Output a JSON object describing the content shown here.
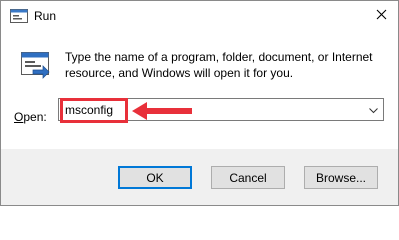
{
  "window": {
    "title": "Run",
    "close_glyph": "✕"
  },
  "icons": {
    "app": "run-app-icon",
    "close": "close-icon",
    "run": "run-program-icon",
    "dropdown": "chevron-down-icon"
  },
  "content": {
    "description": "Type the name of a program, folder, document, or Internet resource, and Windows will open it for you.",
    "open_label_accel": "O",
    "open_label_rest": "pen:",
    "open_value": "msconfig"
  },
  "annotation": {
    "color": "#e8303a"
  },
  "buttons": {
    "ok": "OK",
    "cancel": "Cancel",
    "browse": "Browse..."
  },
  "colors": {
    "accent": "#0078d7",
    "footer_bg": "#f0f0f0",
    "button_bg": "#e1e1e1"
  }
}
